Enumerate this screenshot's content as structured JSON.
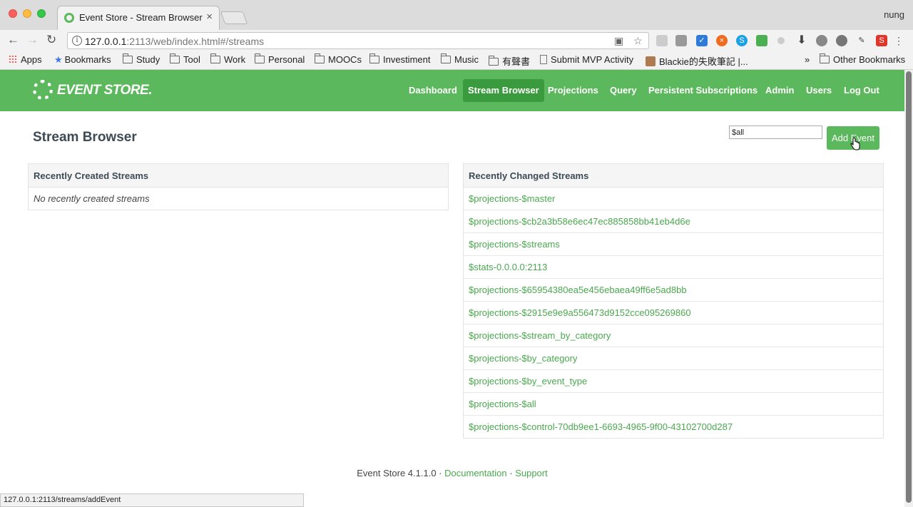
{
  "browser": {
    "tab_title": "Event Store - Stream Browser",
    "tab_close": "×",
    "profile_name": "nung",
    "url_host": "127.0.0.1",
    "url_rest": ":2113/web/index.html#/streams",
    "bookmarks": [
      {
        "label": "Apps",
        "icon": "apps-icon"
      },
      {
        "label": "Bookmarks",
        "icon": "star-icon"
      },
      {
        "label": "Study",
        "icon": "folder-icon"
      },
      {
        "label": "Tool",
        "icon": "folder-icon"
      },
      {
        "label": "Work",
        "icon": "folder-icon"
      },
      {
        "label": "Personal",
        "icon": "folder-icon"
      },
      {
        "label": "MOOCs",
        "icon": "folder-icon"
      },
      {
        "label": "Investiment",
        "icon": "folder-icon"
      },
      {
        "label": "Music",
        "icon": "folder-icon"
      },
      {
        "label": "有聲書",
        "icon": "folder-icon"
      },
      {
        "label": "Submit MVP Activity",
        "icon": "page-icon"
      },
      {
        "label": "Blackie的失敗筆記 |...",
        "icon": "avatar-icon"
      }
    ],
    "bookmarks_overflow": "»",
    "other_bookmarks": "Other Bookmarks",
    "status_url": "127.0.0.1:2113/streams/addEvent"
  },
  "header": {
    "logo_text": "EVENT STORE.",
    "nav": [
      "Dashboard",
      "Stream Browser",
      "Projections",
      "Query",
      "Persistent Subscriptions",
      "Admin",
      "Users",
      "Log Out"
    ],
    "active_nav": "Stream Browser"
  },
  "main": {
    "title": "Stream Browser",
    "stream_input_value": "$all",
    "add_event_label": "Add Event",
    "recently_created": {
      "heading": "Recently Created Streams",
      "empty_text": "No recently created streams"
    },
    "recently_changed": {
      "heading": "Recently Changed Streams",
      "streams": [
        "$projections-$master",
        "$projections-$cb2a3b58e6ec47ec885858bb41eb4d6e",
        "$projections-$streams",
        "$stats-0.0.0.0:2113",
        "$projections-$65954380ea5e456ebaea49ff6e5ad8bb",
        "$projections-$2915e9e9a556473d9152cce095269860",
        "$projections-$stream_by_category",
        "$projections-$by_category",
        "$projections-$by_event_type",
        "$projections-$all",
        "$projections-$control-70db9ee1-6693-4965-9f00-43102700d287"
      ]
    }
  },
  "footer": {
    "version": "Event Store 4.1.1.0",
    "sep": "·",
    "documentation": "Documentation",
    "support": "Support"
  }
}
